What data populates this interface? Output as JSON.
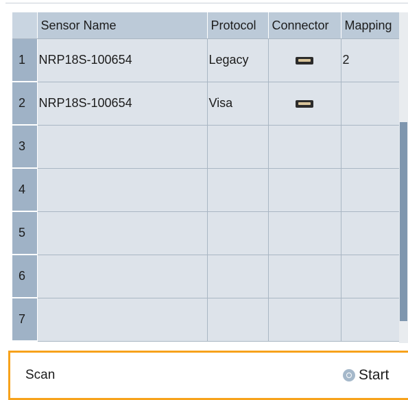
{
  "table": {
    "columns": [
      "Sensor Name",
      "Protocol",
      "Connector",
      "Mapping"
    ],
    "rows": [
      {
        "index": "1",
        "sensor_name": "NRP18S-100654",
        "protocol": "Legacy",
        "connector_icon": "usb-connector-icon",
        "mapping": "2"
      },
      {
        "index": "2",
        "sensor_name": "NRP18S-100654",
        "protocol": "Visa",
        "connector_icon": "usb-connector-icon",
        "mapping": ""
      },
      {
        "index": "3",
        "sensor_name": "",
        "protocol": "",
        "connector_icon": "",
        "mapping": ""
      },
      {
        "index": "4",
        "sensor_name": "",
        "protocol": "",
        "connector_icon": "",
        "mapping": ""
      },
      {
        "index": "5",
        "sensor_name": "",
        "protocol": "",
        "connector_icon": "",
        "mapping": ""
      },
      {
        "index": "6",
        "sensor_name": "",
        "protocol": "",
        "connector_icon": "",
        "mapping": ""
      },
      {
        "index": "7",
        "sensor_name": "",
        "protocol": "",
        "connector_icon": "",
        "mapping": ""
      }
    ]
  },
  "scan": {
    "label": "Scan",
    "button_label": "Start"
  },
  "colors": {
    "header_bg": "#bccad8",
    "cell_bg": "#dde3ea",
    "rownum_bg": "#9fb2c6",
    "focus_border": "#f7a21b",
    "scrollbar_thumb": "#7f96ae"
  }
}
